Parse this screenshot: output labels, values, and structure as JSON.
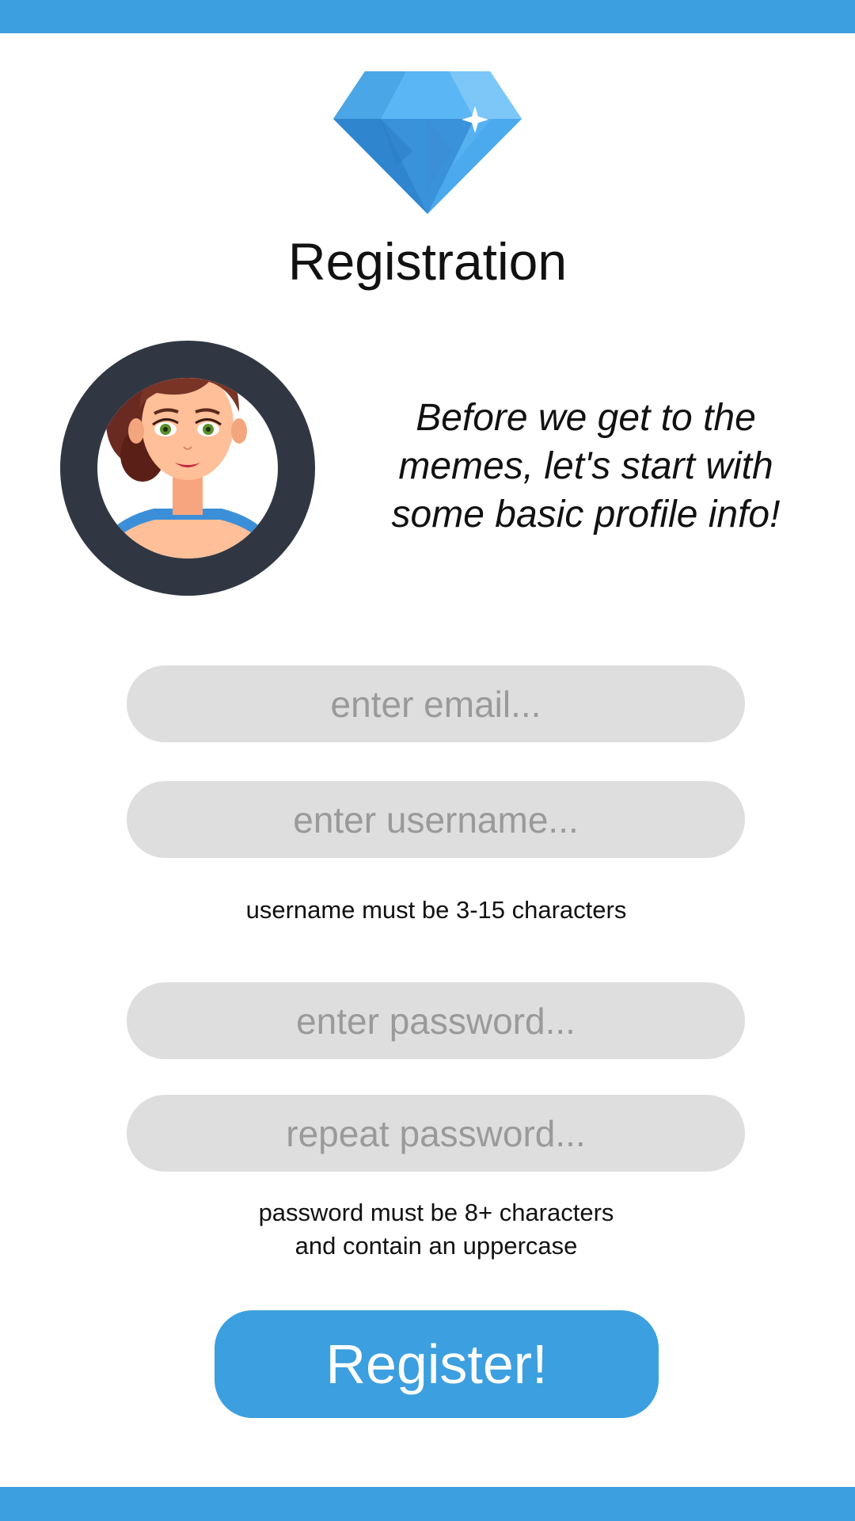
{
  "app": {
    "title": "Registration",
    "logo_icon": "diamond-icon",
    "avatar_icon": "woman-avatar-icon",
    "accent_color": "#3c9fdf"
  },
  "intro": {
    "text": "Before we get to the memes, let's start with some basic profile info!"
  },
  "form": {
    "email": {
      "value": "",
      "placeholder": "enter email..."
    },
    "username": {
      "value": "",
      "placeholder": "enter username..."
    },
    "username_hint": "username must be 3-15 characters",
    "password": {
      "value": "",
      "placeholder": "enter password..."
    },
    "repeat_password": {
      "value": "",
      "placeholder": "repeat password..."
    },
    "password_hint": "password must be 8+ characters\nand contain an uppercase",
    "register_label": "Register!"
  }
}
